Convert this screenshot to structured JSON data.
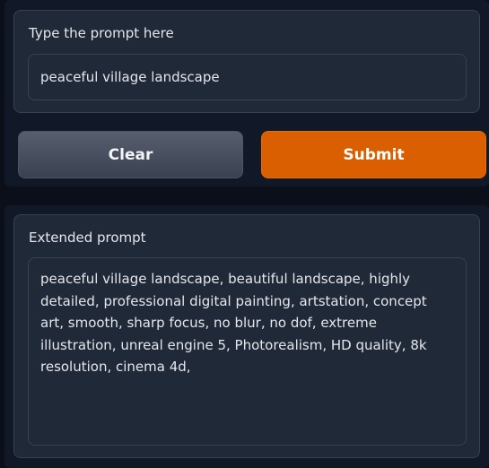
{
  "input_section": {
    "label": "Type the prompt here",
    "value": "peaceful village landscape"
  },
  "buttons": {
    "clear_label": "Clear",
    "submit_label": "Submit"
  },
  "output_section": {
    "label": "Extended prompt",
    "value": "peaceful village landscape, beautiful landscape, highly detailed, professional digital painting, artstation, concept art, smooth, sharp focus, no blur, no dof, extreme illustration, unreal engine 5, Photorealism, HD quality, 8k resolution, cinema 4d,"
  },
  "colors": {
    "background": "#0b0f19",
    "panel": "#111827",
    "block": "#1f2937",
    "border": "#374151",
    "submit": "#d95f00",
    "clear": "#4b5563",
    "text": "#e5e7eb"
  }
}
